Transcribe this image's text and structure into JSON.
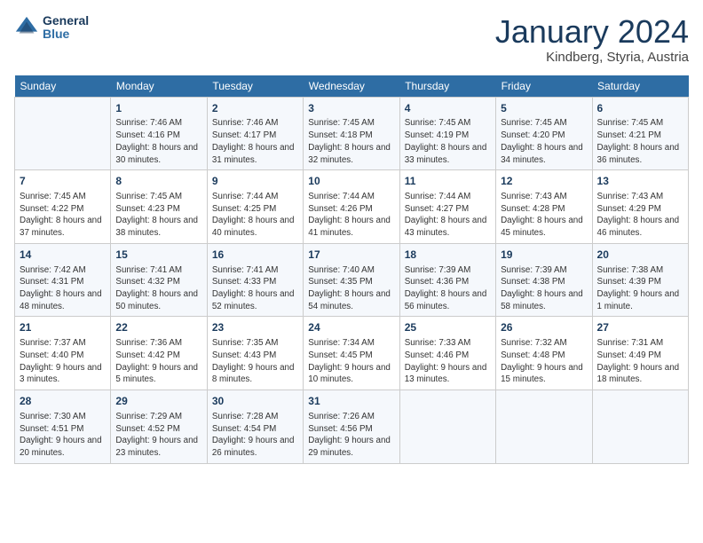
{
  "header": {
    "logo_line1": "General",
    "logo_line2": "Blue",
    "month": "January 2024",
    "location": "Kindberg, Styria, Austria"
  },
  "weekdays": [
    "Sunday",
    "Monday",
    "Tuesday",
    "Wednesday",
    "Thursday",
    "Friday",
    "Saturday"
  ],
  "weeks": [
    [
      {
        "day": "",
        "sunrise": "",
        "sunset": "",
        "daylight": ""
      },
      {
        "day": "1",
        "sunrise": "Sunrise: 7:46 AM",
        "sunset": "Sunset: 4:16 PM",
        "daylight": "Daylight: 8 hours and 30 minutes."
      },
      {
        "day": "2",
        "sunrise": "Sunrise: 7:46 AM",
        "sunset": "Sunset: 4:17 PM",
        "daylight": "Daylight: 8 hours and 31 minutes."
      },
      {
        "day": "3",
        "sunrise": "Sunrise: 7:45 AM",
        "sunset": "Sunset: 4:18 PM",
        "daylight": "Daylight: 8 hours and 32 minutes."
      },
      {
        "day": "4",
        "sunrise": "Sunrise: 7:45 AM",
        "sunset": "Sunset: 4:19 PM",
        "daylight": "Daylight: 8 hours and 33 minutes."
      },
      {
        "day": "5",
        "sunrise": "Sunrise: 7:45 AM",
        "sunset": "Sunset: 4:20 PM",
        "daylight": "Daylight: 8 hours and 34 minutes."
      },
      {
        "day": "6",
        "sunrise": "Sunrise: 7:45 AM",
        "sunset": "Sunset: 4:21 PM",
        "daylight": "Daylight: 8 hours and 36 minutes."
      }
    ],
    [
      {
        "day": "7",
        "sunrise": "Sunrise: 7:45 AM",
        "sunset": "Sunset: 4:22 PM",
        "daylight": "Daylight: 8 hours and 37 minutes."
      },
      {
        "day": "8",
        "sunrise": "Sunrise: 7:45 AM",
        "sunset": "Sunset: 4:23 PM",
        "daylight": "Daylight: 8 hours and 38 minutes."
      },
      {
        "day": "9",
        "sunrise": "Sunrise: 7:44 AM",
        "sunset": "Sunset: 4:25 PM",
        "daylight": "Daylight: 8 hours and 40 minutes."
      },
      {
        "day": "10",
        "sunrise": "Sunrise: 7:44 AM",
        "sunset": "Sunset: 4:26 PM",
        "daylight": "Daylight: 8 hours and 41 minutes."
      },
      {
        "day": "11",
        "sunrise": "Sunrise: 7:44 AM",
        "sunset": "Sunset: 4:27 PM",
        "daylight": "Daylight: 8 hours and 43 minutes."
      },
      {
        "day": "12",
        "sunrise": "Sunrise: 7:43 AM",
        "sunset": "Sunset: 4:28 PM",
        "daylight": "Daylight: 8 hours and 45 minutes."
      },
      {
        "day": "13",
        "sunrise": "Sunrise: 7:43 AM",
        "sunset": "Sunset: 4:29 PM",
        "daylight": "Daylight: 8 hours and 46 minutes."
      }
    ],
    [
      {
        "day": "14",
        "sunrise": "Sunrise: 7:42 AM",
        "sunset": "Sunset: 4:31 PM",
        "daylight": "Daylight: 8 hours and 48 minutes."
      },
      {
        "day": "15",
        "sunrise": "Sunrise: 7:41 AM",
        "sunset": "Sunset: 4:32 PM",
        "daylight": "Daylight: 8 hours and 50 minutes."
      },
      {
        "day": "16",
        "sunrise": "Sunrise: 7:41 AM",
        "sunset": "Sunset: 4:33 PM",
        "daylight": "Daylight: 8 hours and 52 minutes."
      },
      {
        "day": "17",
        "sunrise": "Sunrise: 7:40 AM",
        "sunset": "Sunset: 4:35 PM",
        "daylight": "Daylight: 8 hours and 54 minutes."
      },
      {
        "day": "18",
        "sunrise": "Sunrise: 7:39 AM",
        "sunset": "Sunset: 4:36 PM",
        "daylight": "Daylight: 8 hours and 56 minutes."
      },
      {
        "day": "19",
        "sunrise": "Sunrise: 7:39 AM",
        "sunset": "Sunset: 4:38 PM",
        "daylight": "Daylight: 8 hours and 58 minutes."
      },
      {
        "day": "20",
        "sunrise": "Sunrise: 7:38 AM",
        "sunset": "Sunset: 4:39 PM",
        "daylight": "Daylight: 9 hours and 1 minute."
      }
    ],
    [
      {
        "day": "21",
        "sunrise": "Sunrise: 7:37 AM",
        "sunset": "Sunset: 4:40 PM",
        "daylight": "Daylight: 9 hours and 3 minutes."
      },
      {
        "day": "22",
        "sunrise": "Sunrise: 7:36 AM",
        "sunset": "Sunset: 4:42 PM",
        "daylight": "Daylight: 9 hours and 5 minutes."
      },
      {
        "day": "23",
        "sunrise": "Sunrise: 7:35 AM",
        "sunset": "Sunset: 4:43 PM",
        "daylight": "Daylight: 9 hours and 8 minutes."
      },
      {
        "day": "24",
        "sunrise": "Sunrise: 7:34 AM",
        "sunset": "Sunset: 4:45 PM",
        "daylight": "Daylight: 9 hours and 10 minutes."
      },
      {
        "day": "25",
        "sunrise": "Sunrise: 7:33 AM",
        "sunset": "Sunset: 4:46 PM",
        "daylight": "Daylight: 9 hours and 13 minutes."
      },
      {
        "day": "26",
        "sunrise": "Sunrise: 7:32 AM",
        "sunset": "Sunset: 4:48 PM",
        "daylight": "Daylight: 9 hours and 15 minutes."
      },
      {
        "day": "27",
        "sunrise": "Sunrise: 7:31 AM",
        "sunset": "Sunset: 4:49 PM",
        "daylight": "Daylight: 9 hours and 18 minutes."
      }
    ],
    [
      {
        "day": "28",
        "sunrise": "Sunrise: 7:30 AM",
        "sunset": "Sunset: 4:51 PM",
        "daylight": "Daylight: 9 hours and 20 minutes."
      },
      {
        "day": "29",
        "sunrise": "Sunrise: 7:29 AM",
        "sunset": "Sunset: 4:52 PM",
        "daylight": "Daylight: 9 hours and 23 minutes."
      },
      {
        "day": "30",
        "sunrise": "Sunrise: 7:28 AM",
        "sunset": "Sunset: 4:54 PM",
        "daylight": "Daylight: 9 hours and 26 minutes."
      },
      {
        "day": "31",
        "sunrise": "Sunrise: 7:26 AM",
        "sunset": "Sunset: 4:56 PM",
        "daylight": "Daylight: 9 hours and 29 minutes."
      },
      {
        "day": "",
        "sunrise": "",
        "sunset": "",
        "daylight": ""
      },
      {
        "day": "",
        "sunrise": "",
        "sunset": "",
        "daylight": ""
      },
      {
        "day": "",
        "sunrise": "",
        "sunset": "",
        "daylight": ""
      }
    ]
  ]
}
